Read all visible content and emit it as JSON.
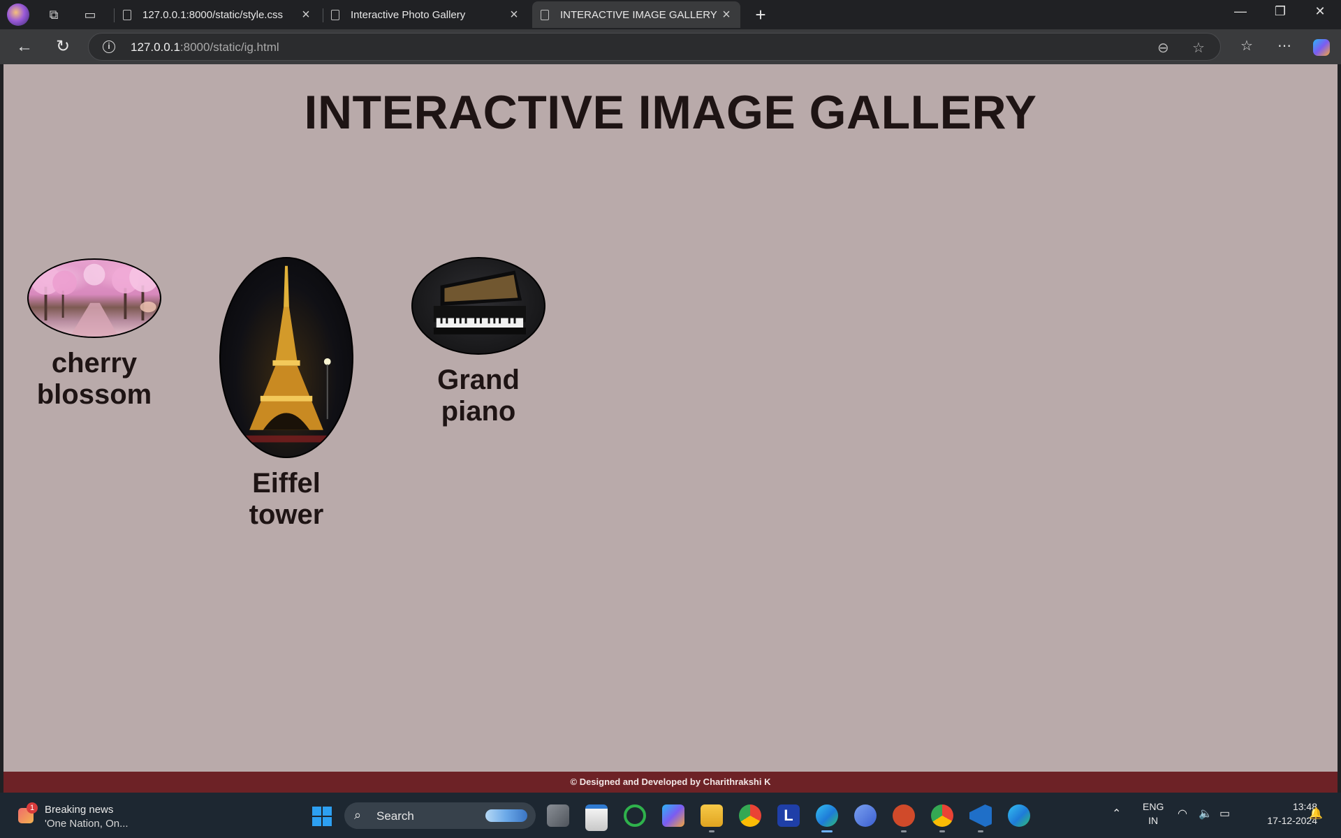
{
  "browser": {
    "tabs": [
      {
        "title": "127.0.0.1:8000/static/style.css",
        "active": false
      },
      {
        "title": "Interactive Photo Gallery",
        "active": false
      },
      {
        "title": "INTERACTIVE IMAGE GALLERY",
        "active": true
      }
    ],
    "url_host": "127.0.0.1",
    "url_path": ":8000/static/ig.html"
  },
  "page": {
    "title": "INTERACTIVE IMAGE GALLERY",
    "gallery": [
      {
        "caption_line1": "cherry",
        "caption_line2": "blossom",
        "image": "cherry-blossom-photo"
      },
      {
        "caption_line1": "Eiffel",
        "caption_line2": "tower",
        "image": "eiffel-tower-photo"
      },
      {
        "caption_line1": "Grand",
        "caption_line2": "piano",
        "image": "grand-piano-photo"
      }
    ],
    "footer": "© Designed and Developed by Charithrakshi K",
    "background_color": "#b9aaaa",
    "footer_color": "#6d2226"
  },
  "taskbar": {
    "news_title": "Breaking news",
    "news_subtitle": "'One Nation, On...",
    "news_badge": "1",
    "search_placeholder": "Search",
    "lang_line1": "ENG",
    "lang_line2": "IN",
    "time": "13:48",
    "date": "17-12-2024"
  }
}
